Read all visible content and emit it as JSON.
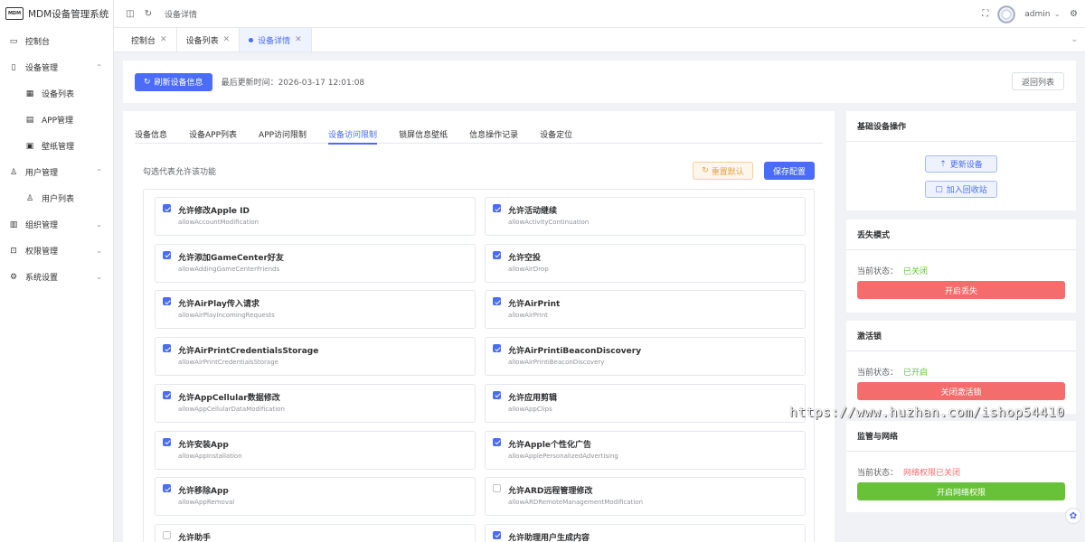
{
  "app": {
    "title": "MDM设备管理系统",
    "logo_text": "MDM"
  },
  "sidebar": {
    "items": [
      {
        "label": "控制台",
        "icon": "monitor-icon"
      },
      {
        "label": "设备管理",
        "icon": "phone-icon"
      },
      {
        "label": "设备列表",
        "icon": "grid-icon"
      },
      {
        "label": "APP管理",
        "icon": "box-icon"
      },
      {
        "label": "壁纸管理",
        "icon": "image-icon"
      },
      {
        "label": "用户管理",
        "icon": "user-icon"
      },
      {
        "label": "用户列表",
        "icon": "user-icon"
      },
      {
        "label": "组织管理",
        "icon": "building-icon"
      },
      {
        "label": "权限管理",
        "icon": "lock-icon"
      },
      {
        "label": "系统设置",
        "icon": "gear-icon"
      }
    ]
  },
  "topbar": {
    "breadcrumb": "设备详情",
    "user": "admin"
  },
  "tabs_bar": {
    "tags": [
      "控制台",
      "设备列表",
      "设备详情"
    ]
  },
  "header": {
    "refresh_label": "刷新设备信息",
    "update_time": "最后更新时间：2026-03-17 12:01:08",
    "back_label": "返回列表"
  },
  "main": {
    "tabs": [
      "设备信息",
      "设备APP列表",
      "APP访问限制",
      "设备访问限制",
      "锁屏信息壁纸",
      "信息操作记录",
      "设备定位"
    ],
    "active_tab": 3,
    "hint": "勾选代表允许该功能",
    "reset_label": "重置默认",
    "save_label": "保存配置",
    "permissions": [
      {
        "name": "允许修改Apple ID",
        "key": "allowAccountModification",
        "checked": true
      },
      {
        "name": "允许活动继续",
        "key": "allowActivityContinuation",
        "checked": true
      },
      {
        "name": "允许添加GameCenter好友",
        "key": "allowAddingGameCenterFriends",
        "checked": true
      },
      {
        "name": "允许空投",
        "key": "allowAirDrop",
        "checked": true
      },
      {
        "name": "允许AirPlay传入请求",
        "key": "allowAirPlayIncomingRequests",
        "checked": true
      },
      {
        "name": "允许AirPrint",
        "key": "allowAirPrint",
        "checked": true
      },
      {
        "name": "允许AirPrintCredentialsStorage",
        "key": "allowAirPrintCredentialsStorage",
        "checked": true
      },
      {
        "name": "允许AirPrintiBeaconDiscovery",
        "key": "allowAirPrintiBeaconDiscovery",
        "checked": true
      },
      {
        "name": "允许AppCellular数据修改",
        "key": "allowAppCellularDataModification",
        "checked": true
      },
      {
        "name": "允许应用剪辑",
        "key": "allowAppClips",
        "checked": true
      },
      {
        "name": "允许安装App",
        "key": "allowAppInstallation",
        "checked": true
      },
      {
        "name": "允许Apple个性化广告",
        "key": "allowApplePersonalizedAdvertising",
        "checked": true
      },
      {
        "name": "允许移除App",
        "key": "allowAppRemoval",
        "checked": true
      },
      {
        "name": "允许ARD远程管理修改",
        "key": "allowARDRemoteManagementModification",
        "checked": false
      },
      {
        "name": "允许助手",
        "key": "",
        "checked": false
      },
      {
        "name": "允许助理用户生成内容",
        "key": "",
        "checked": true
      }
    ]
  },
  "right": {
    "basic": {
      "title": "基础设备操作",
      "update_label": "更新设备",
      "recycle_label": "加入回收站"
    },
    "lost": {
      "title": "丢失模式",
      "status_label": "当前状态：",
      "status": "已关闭",
      "button": "开启丢失",
      "status_color": "#67c23a",
      "button_color": "#f56c6c"
    },
    "activation": {
      "title": "激活锁",
      "status_label": "当前状态：",
      "status": "已开启",
      "button": "关闭激活锁",
      "status_color": "#67c23a",
      "button_color": "#f56c6c"
    },
    "network": {
      "title": "监管与网络",
      "status_label": "当前状态：",
      "status": "网络权限已关闭",
      "button": "开启网络权限",
      "status_color": "#f56c6c",
      "button_color": "#67c23a"
    }
  },
  "watermark": "https://www.huzhan.com/ishop54410",
  "colors": {
    "accent": "#4a6cf7"
  }
}
